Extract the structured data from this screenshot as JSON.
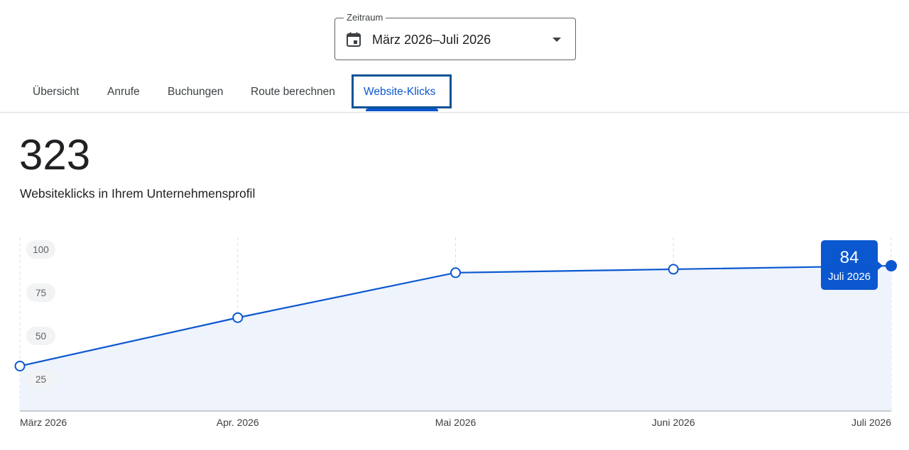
{
  "date_range": {
    "legend": "Zeitraum",
    "value": "März 2026–Juli 2026",
    "icon": "calendar-icon"
  },
  "tabs": [
    {
      "label": "Übersicht",
      "active": false
    },
    {
      "label": "Anrufe",
      "active": false
    },
    {
      "label": "Buchungen",
      "active": false
    },
    {
      "label": "Route berechnen",
      "active": false
    },
    {
      "label": "Website-Klicks",
      "active": true
    }
  ],
  "metric": {
    "value": "323",
    "label": "Websiteklicks in Ihrem Unternehmensprofil"
  },
  "colors": {
    "accent": "#0b57d0",
    "line": "#0b57d0",
    "area_fill": "#eef3fc",
    "tooltip_bg": "#0b57d0"
  },
  "chart_data": {
    "type": "area",
    "categories": [
      "März 2026",
      "Apr. 2026",
      "Mai 2026",
      "Juni 2026",
      "Juli 2026"
    ],
    "series": [
      {
        "values": [
          26,
          54,
          80,
          82,
          84
        ]
      }
    ],
    "yticks": [
      "100",
      "75",
      "50",
      "25"
    ],
    "ylim": [
      0,
      100
    ],
    "grid": true,
    "tooltip": {
      "value": "84",
      "label": "Juli 2026"
    }
  }
}
